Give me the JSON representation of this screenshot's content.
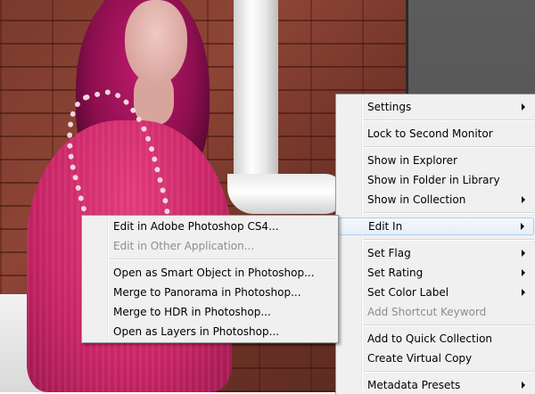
{
  "background": {
    "photo": "woman-with-pink-hair-against-brick-wall",
    "colors": {
      "panel": "#4d4d4d",
      "menu_bg": "#f0f0f0",
      "hover_border": "#aecff7",
      "disabled_text": "#8d8d8d"
    }
  },
  "context_menu": {
    "items": [
      {
        "label": "Settings",
        "submenu": true
      },
      {
        "label": "Lock to Second Monitor"
      },
      {
        "label": "Show in Explorer"
      },
      {
        "label": "Show in Folder in Library"
      },
      {
        "label": "Show in Collection",
        "submenu": true
      },
      {
        "label": "Edit In",
        "submenu": true,
        "highlighted": true
      },
      {
        "label": "Set Flag",
        "submenu": true
      },
      {
        "label": "Set Rating",
        "submenu": true
      },
      {
        "label": "Set Color Label",
        "submenu": true
      },
      {
        "label": "Add Shortcut Keyword",
        "disabled": true
      },
      {
        "label": "Add to Quick Collection"
      },
      {
        "label": "Create Virtual Copy"
      },
      {
        "label": "Metadata Presets",
        "submenu": true
      }
    ]
  },
  "edit_in_submenu": {
    "items": [
      {
        "label": "Edit in Adobe Photoshop CS4..."
      },
      {
        "label": "Edit in Other Application...",
        "disabled": true
      },
      {
        "label": "Open as Smart Object in Photoshop..."
      },
      {
        "label": "Merge to Panorama in Photoshop..."
      },
      {
        "label": "Merge to HDR in Photoshop..."
      },
      {
        "label": "Open as Layers in Photoshop..."
      }
    ]
  }
}
